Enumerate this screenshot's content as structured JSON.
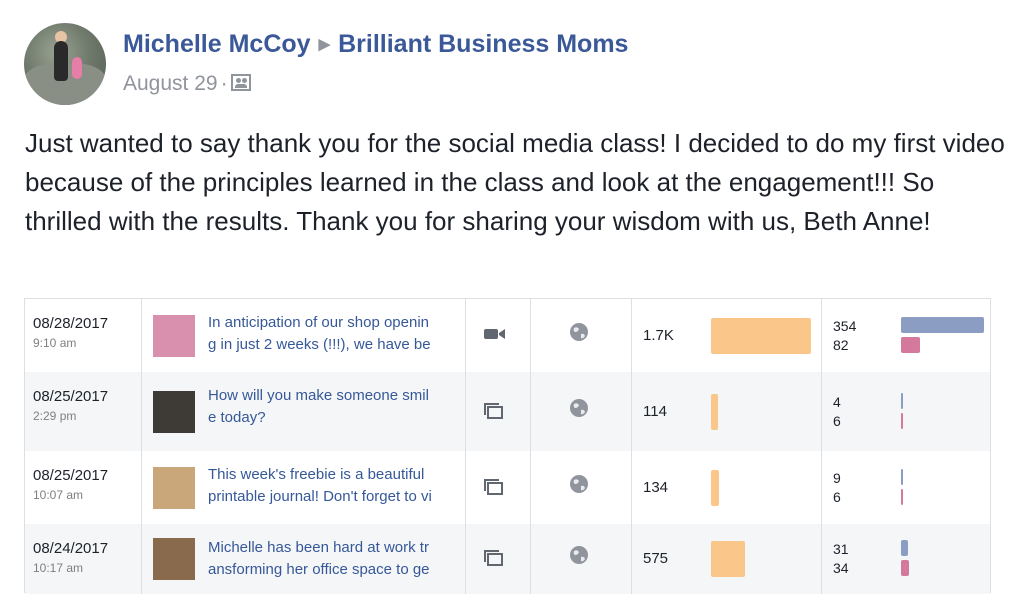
{
  "post": {
    "author": "Michelle McCoy",
    "group": "Brilliant Business Moms",
    "date": "August 29",
    "separator": "·",
    "privacy_icon": "group-icon",
    "body": "Just wanted to say thank you for the social media class! I decided to do my first video because of the principles learned in the class and look at the engagement!!! So thrilled with the results. Thank you for sharing your wisdom with us, Beth Anne!"
  },
  "insights": {
    "rows": [
      {
        "date": "08/28/2017",
        "time": "9:10 am",
        "text": "In anticipation of our shop openin\ng in just 2 weeks (!!!), we have be",
        "type_icon": "video-camera-icon",
        "audience_icon": "globe-icon",
        "reach_label": "1.7K",
        "reach_value": 1700,
        "engagement_top": "354",
        "engagement_bottom": "82",
        "engagement_top_value": 354,
        "engagement_bottom_value": 82,
        "thumb_color": "#d98fae"
      },
      {
        "date": "08/25/2017",
        "time": "2:29 pm",
        "text": "How will you make someone smil\ne today?",
        "type_icon": "album-icon",
        "audience_icon": "globe-icon",
        "reach_label": "114",
        "reach_value": 114,
        "engagement_top": "4",
        "engagement_bottom": "6",
        "engagement_top_value": 4,
        "engagement_bottom_value": 6,
        "thumb_color": "#3e3a36"
      },
      {
        "date": "08/25/2017",
        "time": "10:07 am",
        "text": "This week's freebie is a beautiful\nprintable journal! Don't forget to vi",
        "type_icon": "album-icon",
        "audience_icon": "globe-icon",
        "reach_label": "134",
        "reach_value": 134,
        "engagement_top": "9",
        "engagement_bottom": "6",
        "engagement_top_value": 9,
        "engagement_bottom_value": 6,
        "thumb_color": "#c9a77b"
      },
      {
        "date": "08/24/2017",
        "time": "10:17 am",
        "text": "Michelle has been hard at work tr\nansforming her office space to ge",
        "type_icon": "album-icon",
        "audience_icon": "globe-icon",
        "reach_label": "575",
        "reach_value": 575,
        "engagement_top": "31",
        "engagement_bottom": "34",
        "engagement_top_value": 31,
        "engagement_bottom_value": 34,
        "thumb_color": "#8a6a4d"
      }
    ]
  },
  "colors": {
    "link": "#3b5998",
    "reach_bar": "#fbc689",
    "engagement_top_bar": "#8b9dc3",
    "engagement_bottom_bar": "#d4799b"
  }
}
